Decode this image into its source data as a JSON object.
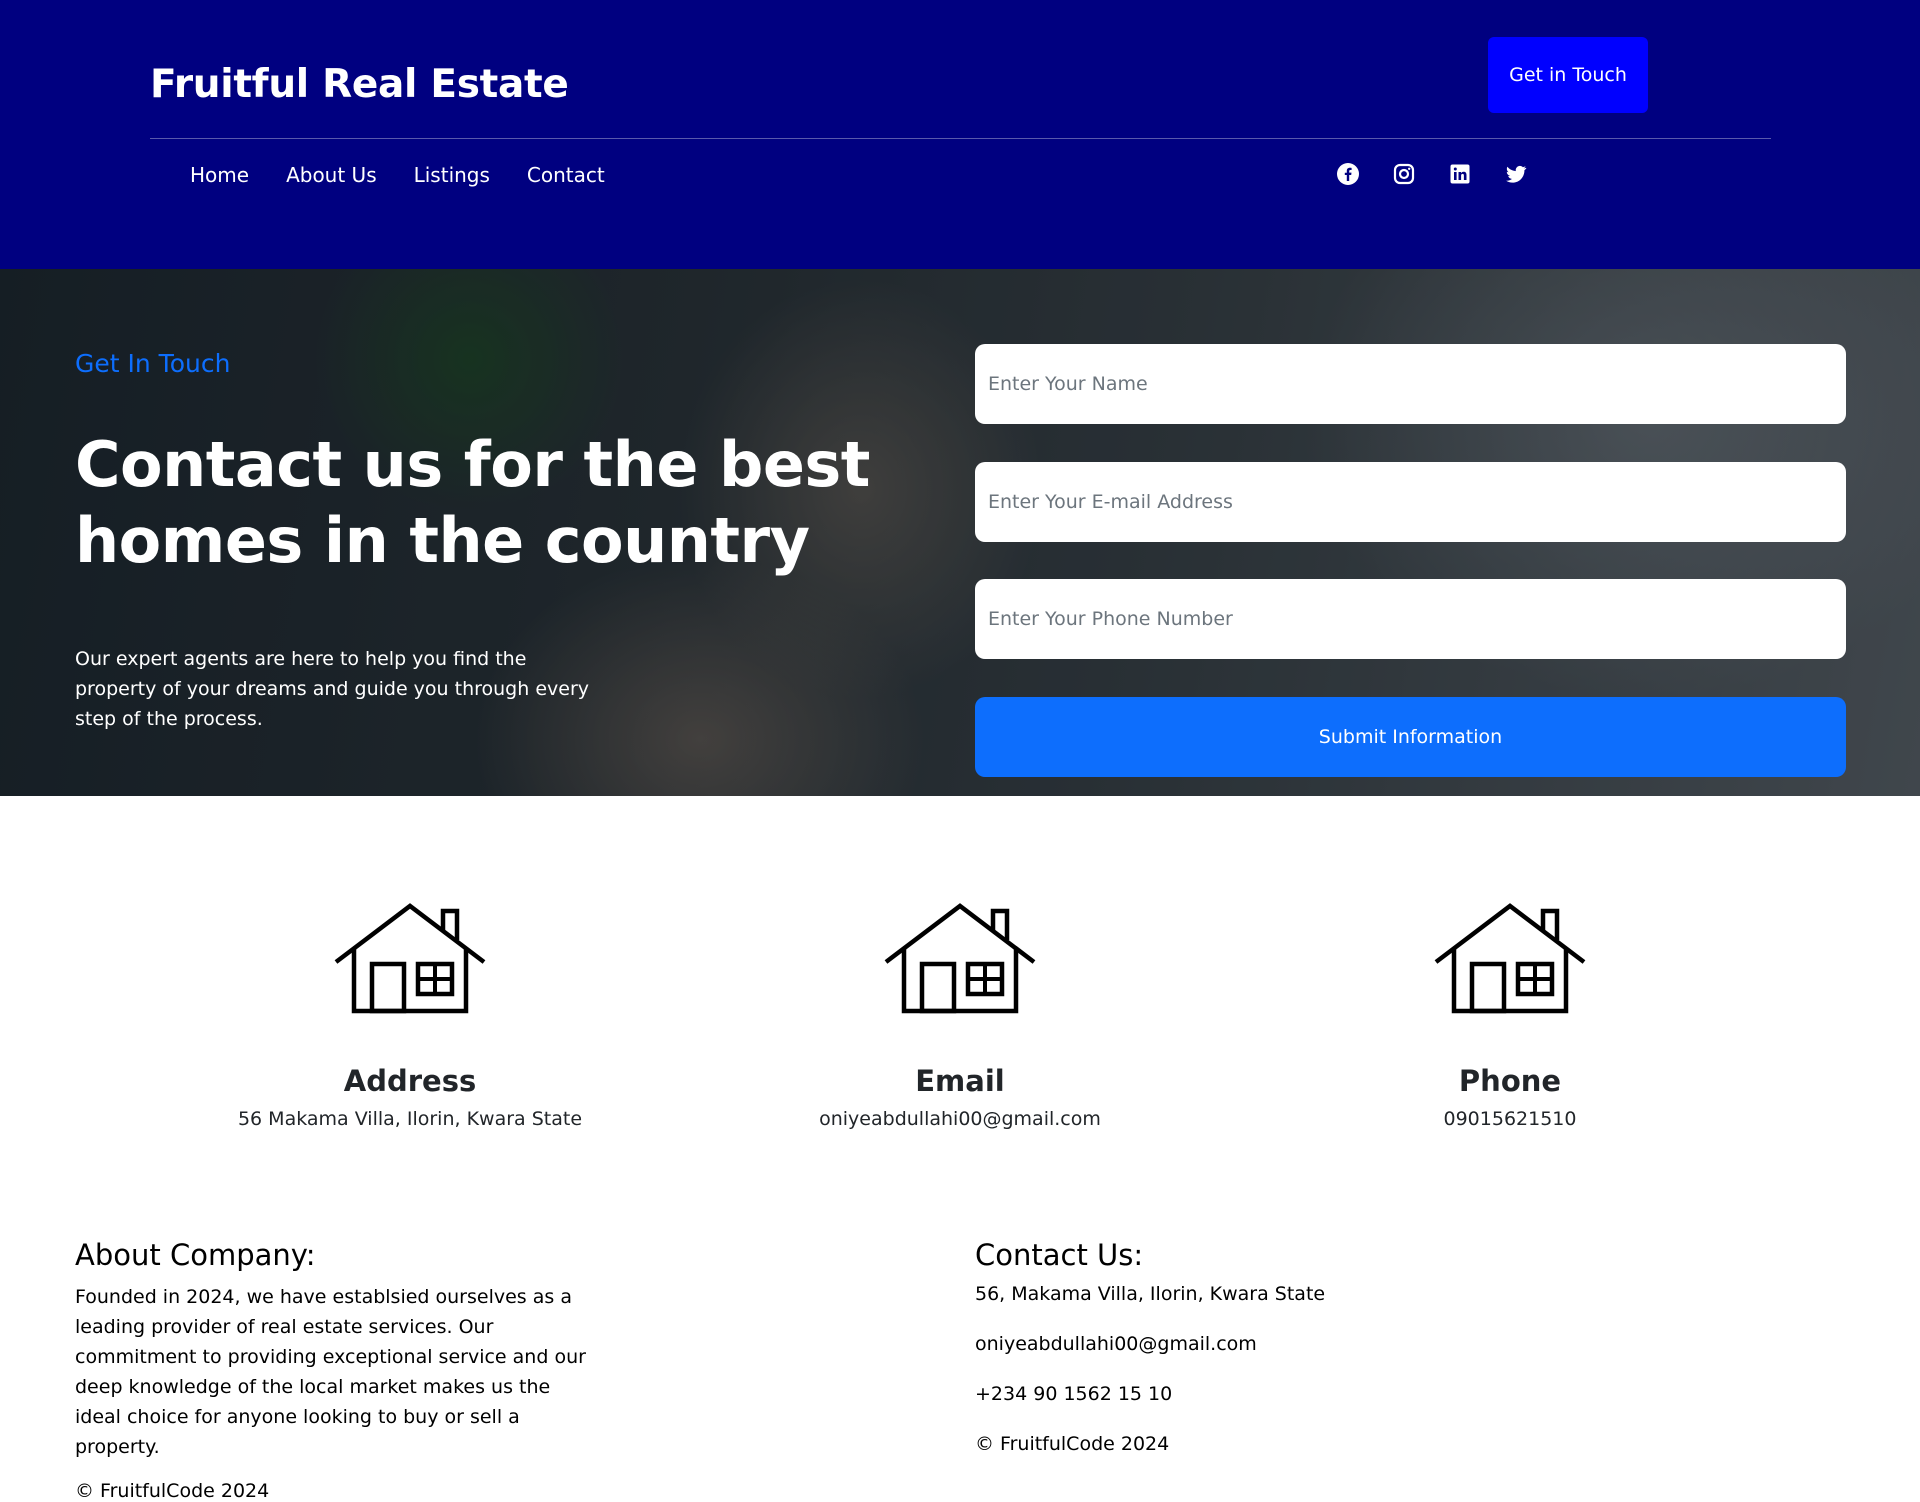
{
  "header": {
    "brand": "Fruitful Real Estate",
    "cta_label": "Get in Touch",
    "nav": [
      "Home",
      "About Us",
      "Listings",
      "Contact"
    ],
    "socials": [
      "facebook-icon",
      "instagram-icon",
      "linkedin-icon",
      "twitter-icon"
    ]
  },
  "hero": {
    "eyebrow": "Get In Touch",
    "title": "Contact us for the best homes in the country",
    "text": "Our expert agents are here to help you find the property of your dreams and guide you through every step of the process.",
    "form": {
      "name_placeholder": "Enter Your Name",
      "email_placeholder": "Enter Your E-mail Address",
      "phone_placeholder": "Enter Your Phone Number",
      "submit_label": "Submit Information"
    }
  },
  "cards": [
    {
      "icon": "house-icon",
      "title": "Address",
      "value": "56 Makama Villa, Ilorin, Kwara State"
    },
    {
      "icon": "house-icon",
      "title": "Email",
      "value": "oniyeabdullahi00@gmail.com"
    },
    {
      "icon": "house-icon",
      "title": "Phone",
      "value": "09015621510"
    }
  ],
  "footer": {
    "about_heading": "About Company:",
    "about_text": "Founded in 2024, we have establsied ourselves as a leading provider of real estate services. Our commitment to providing exceptional service and our deep knowledge of the local market makes us the ideal choice for anyone looking to buy or sell a property.",
    "about_copy": "© FruitfulCode 2024",
    "contact_heading": "Contact Us:",
    "contact_address": "56, Makama Villa, Ilorin, Kwara State",
    "contact_email": "oniyeabdullahi00@gmail.com",
    "contact_phone": "+234 90 1562 15 10",
    "contact_copy": "© FruitfulCode 2024"
  },
  "colors": {
    "header_bg": "#000080",
    "cta_bg": "#0000ff",
    "accent": "#0d6efd"
  }
}
